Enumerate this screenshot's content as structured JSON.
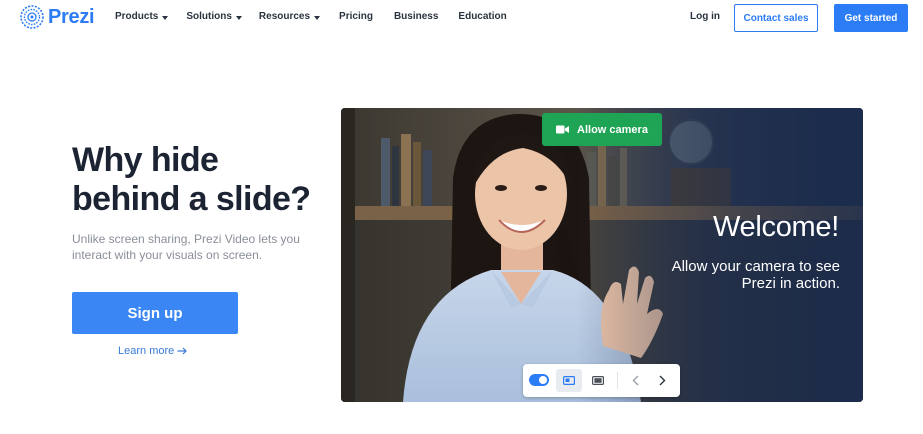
{
  "brand": {
    "name": "Prezi",
    "icon": "prezi-logo-icon",
    "color": "#2c7cf6"
  },
  "nav": {
    "menu": [
      {
        "label": "Products",
        "has_dropdown": true
      },
      {
        "label": "Solutions",
        "has_dropdown": true
      },
      {
        "label": "Resources",
        "has_dropdown": true
      },
      {
        "label": "Pricing",
        "has_dropdown": false
      },
      {
        "label": "Business",
        "has_dropdown": false
      },
      {
        "label": "Education",
        "has_dropdown": false
      }
    ],
    "login": "Log in",
    "contact_sales": "Contact sales",
    "get_started": "Get started"
  },
  "hero": {
    "headline": "Why hide behind a slide?",
    "subtext": "Unlike screen sharing, Prezi Video lets you interact with your visuals on screen.",
    "signup": "Sign up",
    "learn_more": "Learn more",
    "learn_more_icon": "arrow-right-icon"
  },
  "video": {
    "allow_camera": "Allow camera",
    "allow_camera_icon": "video-camera-icon",
    "welcome": "Welcome!",
    "allow_message": "Allow your camera to see Prezi in action.",
    "controls": {
      "toggle_icon": "toggle-switch-icon",
      "toggle_on": true,
      "layout_1_icon": "picture-in-picture-icon",
      "layout_2_icon": "fullscreen-layout-icon",
      "prev_icon": "chevron-left-icon",
      "next_icon": "chevron-right-icon"
    }
  },
  "colors": {
    "accent": "#2c7cf6",
    "signup": "#3a86f5",
    "allow_camera": "#1fa355",
    "panel_overlay": "#1b2c4d"
  }
}
